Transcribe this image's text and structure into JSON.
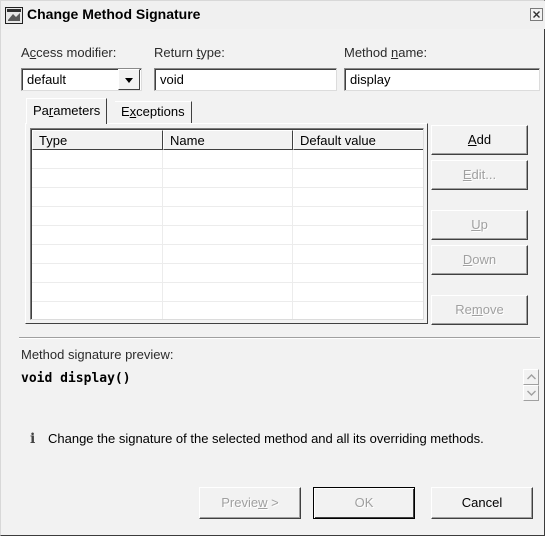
{
  "window": {
    "title": "Change Method Signature"
  },
  "fields": {
    "access_modifier": {
      "label_pre": "A",
      "label_key": "c",
      "label_post": "cess modifier:",
      "value": "default"
    },
    "return_type": {
      "label_pre": "Return ",
      "label_key": "t",
      "label_post": "ype:",
      "value": "void"
    },
    "method_name": {
      "label_pre": "Method ",
      "label_key": "n",
      "label_post": "ame:",
      "value": "display"
    }
  },
  "tabs": [
    {
      "pre": "Pa",
      "key": "r",
      "post": "ameters",
      "selected": true
    },
    {
      "pre": "E",
      "key": "x",
      "post": "ceptions",
      "selected": false
    }
  ],
  "table": {
    "columns": [
      "Type",
      "Name",
      "Default value"
    ],
    "rows": []
  },
  "side_buttons": {
    "add": {
      "key": "A",
      "post": "dd",
      "enabled": true
    },
    "edit": {
      "key": "E",
      "post": "dit...",
      "enabled": false
    },
    "up": {
      "key": "U",
      "post": "p",
      "enabled": false
    },
    "down": {
      "key": "D",
      "post": "own",
      "enabled": false
    },
    "remove": {
      "pre": "Re",
      "key": "m",
      "post": "ove",
      "enabled": false
    }
  },
  "preview": {
    "label": "Method signature preview:",
    "signature": "void display()"
  },
  "info": {
    "icon": "info-icon",
    "message": "Change the signature of the selected method and all its overriding methods."
  },
  "bottom_buttons": {
    "preview": {
      "pre": "Previe",
      "key": "w",
      "post": " >",
      "enabled": false
    },
    "ok": {
      "label": "OK",
      "enabled": false
    },
    "cancel": {
      "label": "Cancel",
      "enabled": true
    }
  }
}
